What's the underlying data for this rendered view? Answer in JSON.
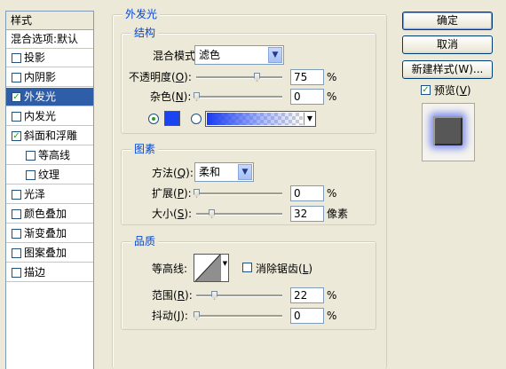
{
  "sidebar": {
    "header": "样式",
    "blend_options": "混合选项:默认",
    "items": [
      {
        "label": "投影",
        "checked": false
      },
      {
        "label": "内阴影",
        "checked": false
      },
      {
        "label": "外发光",
        "checked": true
      },
      {
        "label": "内发光",
        "checked": false
      },
      {
        "label": "斜面和浮雕",
        "checked": true
      },
      {
        "label": "等高线",
        "checked": false
      },
      {
        "label": "纹理",
        "checked": false
      },
      {
        "label": "光泽",
        "checked": false
      },
      {
        "label": "颜色叠加",
        "checked": false
      },
      {
        "label": "渐变叠加",
        "checked": false
      },
      {
        "label": "图案叠加",
        "checked": false
      },
      {
        "label": "描边",
        "checked": false
      }
    ]
  },
  "outer_glow": {
    "title": "外发光",
    "structure": {
      "title": "结构",
      "blend_mode_label": "混合模式:",
      "blend_mode_value": "滤色",
      "opacity_label_pre": "不透明度(",
      "opacity_key": "O",
      "opacity_label_post": "):",
      "opacity_value": "75",
      "opacity_level": 0.75,
      "noise_label_pre": "杂色(",
      "noise_key": "N",
      "noise_label_post": "):",
      "noise_value": "0",
      "noise_level": 0,
      "percent": "%",
      "glow_color": "#1a44f0"
    },
    "elements": {
      "title": "图素",
      "technique_label": "方法(",
      "technique_key": "Q",
      "technique_label_post": "):",
      "technique_value": "柔和",
      "spread_label_pre": "扩展(",
      "spread_key": "P",
      "spread_label_post": "):",
      "spread_value": "0",
      "spread_level": 0,
      "size_label_pre": "大小(",
      "size_key": "S",
      "size_label_post": "):",
      "size_value": "32",
      "size_unit": "像素",
      "percent": "%"
    },
    "quality": {
      "title": "品质",
      "contour_label": "等高线:",
      "anti_alias_pre": "消除锯齿(",
      "anti_alias_key": "L",
      "anti_alias_post": ")",
      "range_label_pre": "范围(",
      "range_key": "R",
      "range_label_post": "):",
      "range_value": "22",
      "jitter_label_pre": "抖动(",
      "jitter_key": "J",
      "jitter_label_post": "):",
      "jitter_value": "0",
      "percent": "%"
    }
  },
  "buttons": {
    "ok": "确定",
    "cancel": "取消",
    "new_style": "新建样式(W)...",
    "preview_pre": "预览(",
    "preview_key": "V",
    "preview_post": ")",
    "preview_checked": true
  }
}
